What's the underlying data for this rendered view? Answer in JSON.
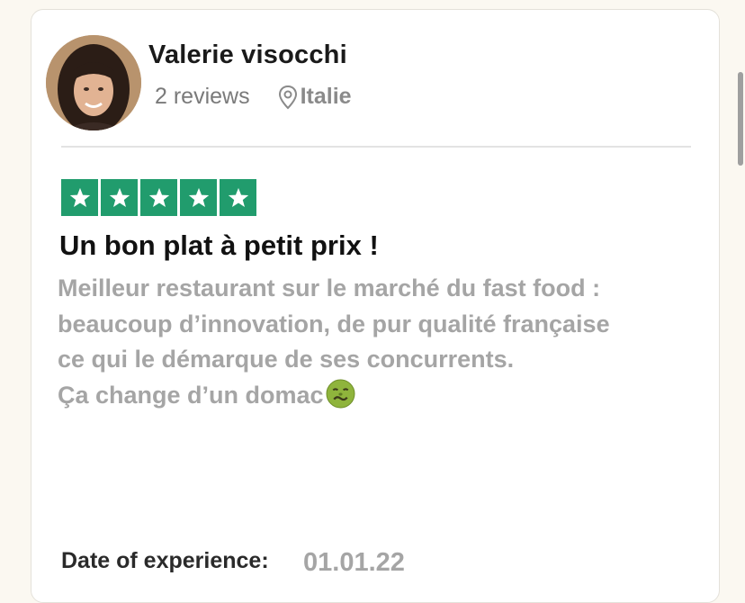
{
  "reviewer": {
    "name": "Valerie visocchi",
    "review_count": "2 reviews",
    "location": "Italie",
    "avatar_icon": "user-avatar-photo",
    "location_icon": "map-pin-icon"
  },
  "rating": {
    "stars": 5,
    "max": 5,
    "color": "#219c6d",
    "icon": "star-icon"
  },
  "review": {
    "title": "Un bon plat à petit prix !",
    "lines": [
      "Meilleur restaurant sur le marché du fast food :",
      "beaucoup d’innovation, de pur qualité française",
      "ce qui le démarque de ses concurrents.",
      "Ça change d’un domac"
    ],
    "emoji": "nauseated-face-emoji"
  },
  "experience": {
    "label": "Date of experience:",
    "date": "01.01.22"
  }
}
